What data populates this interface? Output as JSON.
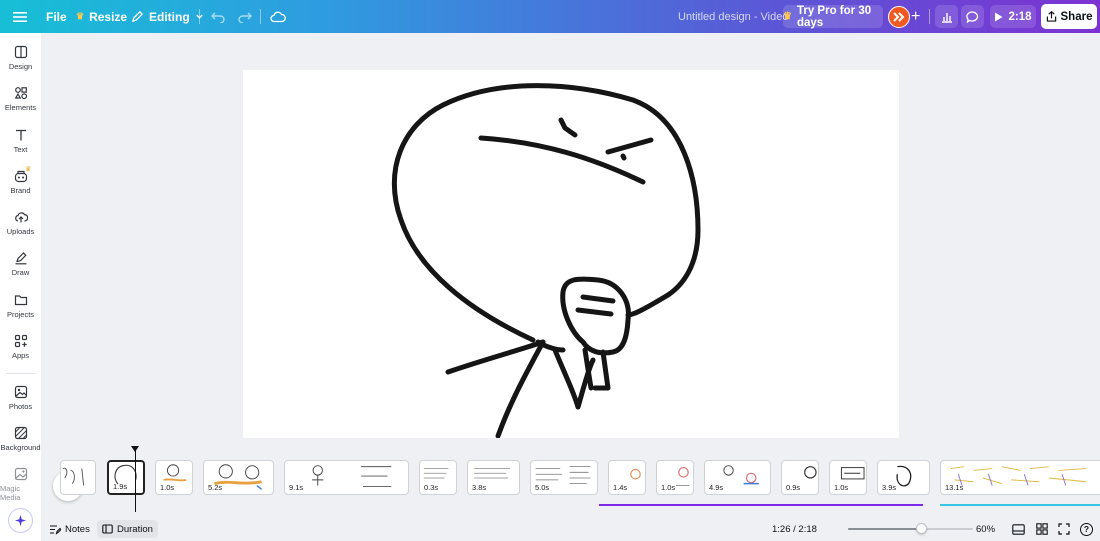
{
  "topbar": {
    "file_label": "File",
    "resize_label": "Resize",
    "editing_label": "Editing",
    "doc_title": "Untitled design - Video",
    "try_pro_label": "Try Pro for 30 days",
    "play_duration": "2:18",
    "share_label": "Share"
  },
  "sidebar": {
    "items": [
      {
        "label": "Design",
        "icon": "layout-icon"
      },
      {
        "label": "Elements",
        "icon": "shapes-icon"
      },
      {
        "label": "Text",
        "icon": "text-icon"
      },
      {
        "label": "Brand",
        "icon": "brand-icon"
      },
      {
        "label": "Uploads",
        "icon": "upload-cloud-icon"
      },
      {
        "label": "Draw",
        "icon": "pen-icon"
      },
      {
        "label": "Projects",
        "icon": "folder-icon"
      },
      {
        "label": "Apps",
        "icon": "apps-grid-icon"
      },
      {
        "label": "Photos",
        "icon": "image-icon"
      },
      {
        "label": "Background",
        "icon": "pattern-icon"
      },
      {
        "label": "Magic Media",
        "icon": "magic-media-icon"
      }
    ]
  },
  "timeline": {
    "clips": [
      {
        "duration": ""
      },
      {
        "duration": "1.9s"
      },
      {
        "duration": "1.0s"
      },
      {
        "duration": "5.2s"
      },
      {
        "duration": "9.1s"
      },
      {
        "duration": "0.3s"
      },
      {
        "duration": "3.8s"
      },
      {
        "duration": "5.0s"
      },
      {
        "duration": "1.4s"
      },
      {
        "duration": "1.0s"
      },
      {
        "duration": "4.9s"
      },
      {
        "duration": "0.9s"
      },
      {
        "duration": "1.0s"
      },
      {
        "duration": "3.9s"
      },
      {
        "duration": "13.1s"
      }
    ]
  },
  "bottombar": {
    "notes_label": "Notes",
    "duration_label": "Duration",
    "time_position": "1:26 / 2:18",
    "zoom_level": "60%",
    "zoom_fraction": 0.6,
    "help_label": "?"
  },
  "colors": {
    "accent_purple": "#7d2ae8",
    "accent_cyan": "#35c6e4",
    "selected_clip_border": "#222222"
  }
}
